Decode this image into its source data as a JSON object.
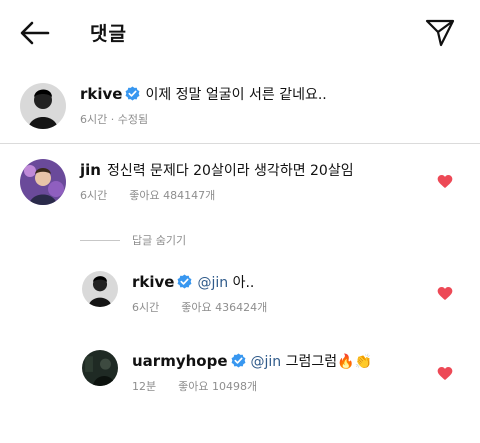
{
  "header": {
    "title": "댓글",
    "back_icon": "arrow-left-icon",
    "send_icon": "paper-plane-icon"
  },
  "caption": {
    "username": "rkive",
    "verified": true,
    "text": "이제 정말 얼굴이 서른 같네요..",
    "time": "6시간",
    "edited": "수정됨",
    "separator": " · "
  },
  "comments": [
    {
      "username": "jin",
      "verified": false,
      "text": "정신력 문제다 20살이라 생각하면 20살임",
      "time": "6시간",
      "likes": "좋아요 484147개",
      "liked": true
    }
  ],
  "replies_toggle": "답글 숨기기",
  "replies": [
    {
      "username": "rkive",
      "verified": true,
      "mention": "@jin",
      "text": " 아..",
      "time": "6시간",
      "likes": "좋아요 436424개",
      "liked": true
    },
    {
      "username": "uarmyhope",
      "verified": true,
      "mention": "@jin",
      "text": " 그럼그럼",
      "emoji": "🔥👏",
      "time": "12분",
      "likes": "좋아요 10498개",
      "liked": true
    }
  ],
  "colors": {
    "heart": "#ed4956",
    "verified": "#3897f0",
    "meta": "#8e8e8e",
    "mention": "#2f5a8a"
  }
}
